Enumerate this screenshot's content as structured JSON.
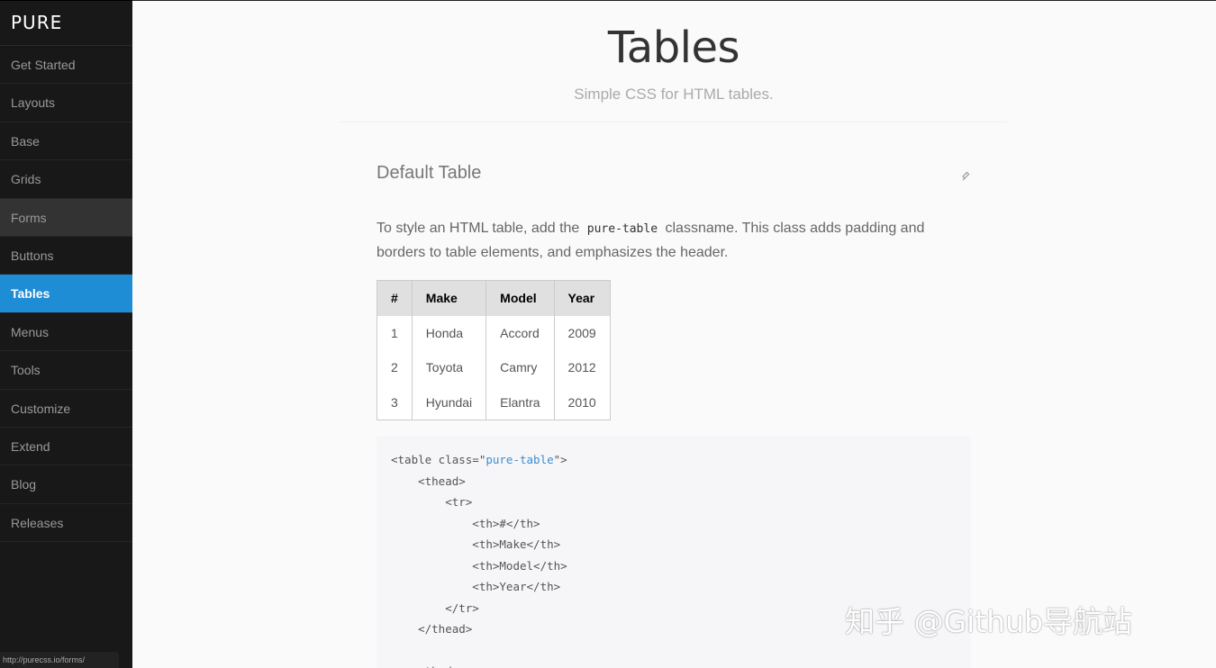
{
  "sidebar": {
    "brand": "PURE",
    "items": [
      {
        "label": "Get Started"
      },
      {
        "label": "Layouts"
      },
      {
        "label": "Base"
      },
      {
        "label": "Grids"
      },
      {
        "label": "Forms"
      },
      {
        "label": "Buttons"
      },
      {
        "label": "Tables"
      },
      {
        "label": "Menus"
      },
      {
        "label": "Tools"
      },
      {
        "label": "Customize"
      },
      {
        "label": "Extend"
      },
      {
        "label": "Blog"
      },
      {
        "label": "Releases"
      }
    ],
    "active_item": "Tables",
    "hover_item": "Forms"
  },
  "status_bar": {
    "url": "http://purecss.io/forms/"
  },
  "header": {
    "title": "Tables",
    "subtitle": "Simple CSS for HTML tables."
  },
  "section": {
    "heading": "Default Table",
    "anchor_icon": "link-icon",
    "desc_before": "To style an HTML table, add the",
    "desc_code": "pure-table",
    "desc_after": "classname. This class adds padding and borders to table elements, and emphasizes the header."
  },
  "table": {
    "headers": [
      "#",
      "Make",
      "Model",
      "Year"
    ],
    "rows": [
      [
        "1",
        "Honda",
        "Accord",
        "2009"
      ],
      [
        "2",
        "Toyota",
        "Camry",
        "2012"
      ],
      [
        "3",
        "Hyundai",
        "Elantra",
        "2010"
      ]
    ]
  },
  "code_sample": {
    "l1_a": "<table class=\"",
    "l1_str": "pure-table",
    "l1_b": "\">",
    "l2": "    <thead>",
    "l3": "        <tr>",
    "l4": "            <th>#</th>",
    "l5": "            <th>Make</th>",
    "l6": "            <th>Model</th>",
    "l7": "            <th>Year</th>",
    "l8": "        </tr>",
    "l9": "    </thead>",
    "l10": "",
    "l11": "    <tbody>"
  },
  "watermark": "知乎 @Github导航站",
  "colors": {
    "sidebar_bg": "#191818",
    "active_bg": "#1f8dd6",
    "code_string": "#3b8ccf"
  }
}
